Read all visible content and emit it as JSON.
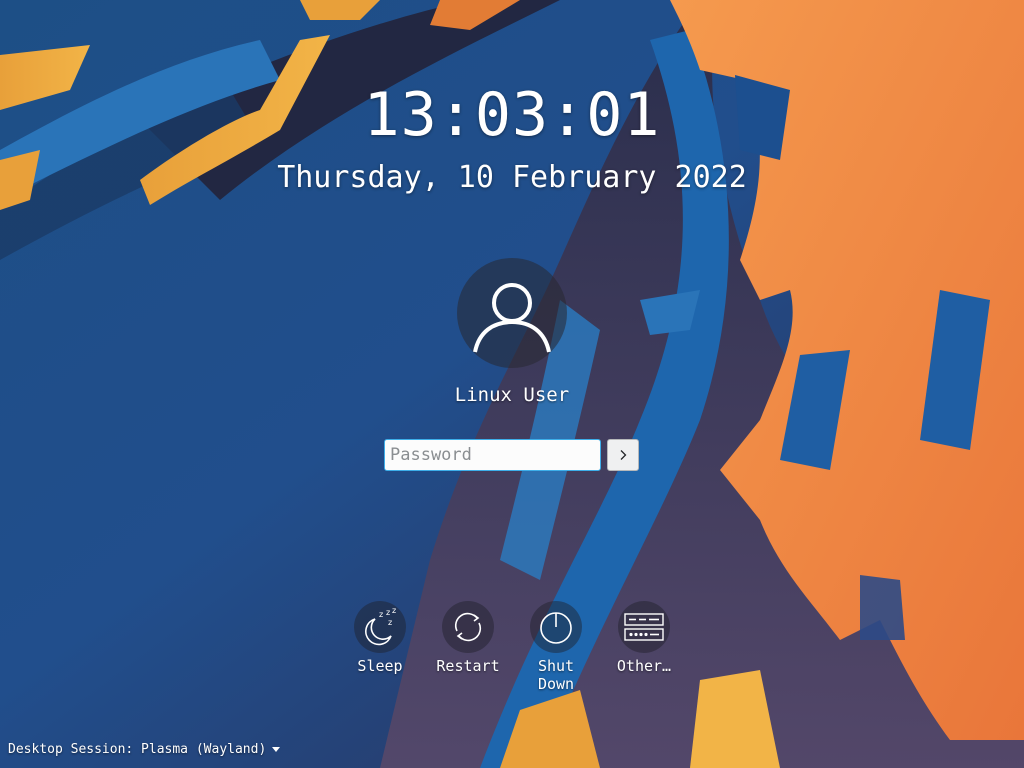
{
  "clock": {
    "time": "13:03:01",
    "date": "Thursday, 10 February 2022"
  },
  "user": {
    "name": "Linux User",
    "avatar_icon": "user-avatar-icon"
  },
  "login": {
    "password_placeholder": "Password",
    "submit_icon": "chevron-right-icon"
  },
  "actions": [
    {
      "label": "Sleep",
      "icon": "sleep-icon"
    },
    {
      "label": "Restart",
      "icon": "restart-icon"
    },
    {
      "label": "Shut Down",
      "icon": "power-icon"
    },
    {
      "label": "Other…",
      "icon": "other-options-icon"
    }
  ],
  "session": {
    "label": "Desktop Session: Plasma (Wayland)"
  },
  "colors": {
    "accent": "#3daee9",
    "wallpaper_blue": "#1c5a8c",
    "wallpaper_orange": "#f08c46",
    "wallpaper_purple": "#3a3750"
  }
}
